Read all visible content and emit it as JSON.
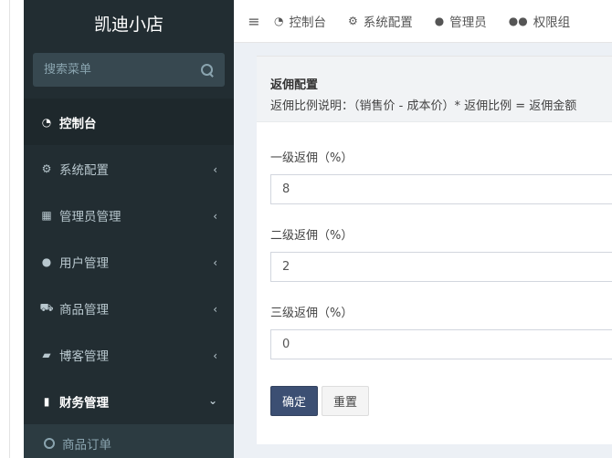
{
  "app": {
    "brand": "凯迪小店"
  },
  "sidebar": {
    "search_placeholder": "搜索菜单",
    "items": [
      {
        "label": "控制台",
        "icon": "dashboard-icon",
        "glyph": "◔"
      },
      {
        "label": "系统配置",
        "icon": "cogs-icon",
        "glyph": "⚙"
      },
      {
        "label": "管理员管理",
        "icon": "windows-icon",
        "glyph": "▦"
      },
      {
        "label": "用户管理",
        "icon": "user-icon",
        "glyph": "●"
      },
      {
        "label": "商品管理",
        "icon": "cart-icon",
        "glyph": "⛟"
      },
      {
        "label": "博客管理",
        "icon": "book-icon",
        "glyph": "▰"
      },
      {
        "label": "财务管理",
        "icon": "bookmark-icon",
        "glyph": "▮"
      }
    ],
    "submenu": {
      "label": "商品订单"
    }
  },
  "topbar": {
    "toggle_glyph": "≡",
    "items": [
      {
        "label": "控制台",
        "icon": "dashboard-icon",
        "glyph": "◔"
      },
      {
        "label": "系统配置",
        "icon": "gear-icon",
        "glyph": "⚙"
      },
      {
        "label": "管理员",
        "icon": "user-icon",
        "glyph": "●"
      },
      {
        "label": "权限组",
        "icon": "users-icon",
        "glyph": "●●"
      }
    ]
  },
  "panel": {
    "title": "返佣配置",
    "description": "返佣比例说明：（销售价 - 成本价）* 返佣比例 = 返佣金额"
  },
  "form": {
    "level1": {
      "label": "一级返佣（%）",
      "value": "8"
    },
    "level2": {
      "label": "二级返佣（%）",
      "value": "2"
    },
    "level3": {
      "label": "三级返佣（%）",
      "value": "0"
    },
    "submit_label": "确定",
    "reset_label": "重置"
  },
  "colors": {
    "sidebar_bg": "#222d32",
    "primary_button": "#3c4f73"
  }
}
